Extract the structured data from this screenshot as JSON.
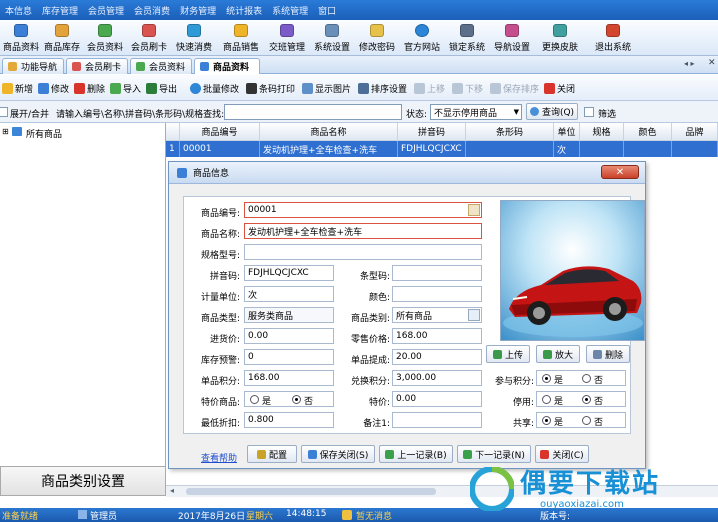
{
  "menubar": {
    "items": [
      "本信息",
      "库存管理",
      "会员管理",
      "会员消费",
      "财务管理",
      "统计报表",
      "系统管理",
      "窗口"
    ]
  },
  "toolbar": {
    "items": [
      "商品资料",
      "商品库存",
      "会员资料",
      "会员刷卡",
      "快速消费",
      "商品销售",
      "交班管理",
      "系统设置",
      "修改密码",
      "官方网站",
      "锁定系统",
      "导航设置",
      "更换皮肤",
      "退出系统"
    ]
  },
  "tabs": [
    "功能导航",
    "会员刷卡",
    "会员资料",
    "商品资料"
  ],
  "actions": {
    "add": "新增",
    "edit": "修改",
    "delete": "删除",
    "import": "导入",
    "export": "导出",
    "batch_edit": "批量修改",
    "barcode_print": "条码打印",
    "show_image": "显示图片",
    "sort_settings": "排序设置",
    "move_up": "上移",
    "move_down": "下移",
    "save_sort": "保存排序",
    "close": "关闭"
  },
  "search": {
    "expand_label": "展开/合并",
    "prompt": "请输入编号\\名称\\拼音码\\条形码\\规格查找:",
    "query": "",
    "status_label": "状态:",
    "status_value": "不显示停用商品",
    "query_button": "查询(Q)",
    "filter_label": "筛选"
  },
  "tree": {
    "root": "所有商品"
  },
  "category_button": "商品类别设置",
  "grid": {
    "headers": [
      "商品编号",
      "商品名称",
      "拼音码",
      "条形码",
      "单位",
      "规格",
      "颜色",
      "品牌"
    ],
    "rows": [
      {
        "index": "1",
        "code": "00001",
        "name": "发动机护理+全车检查+洗车",
        "pinyin": "FDJHLQCJCXC",
        "barcode": "",
        "unit": "次",
        "spec": "",
        "color": "",
        "brand": ""
      }
    ]
  },
  "dialog": {
    "title": "商品信息",
    "labels": {
      "code": "商品编号:",
      "name": "商品名称:",
      "spec": "规格型号:",
      "pinyin": "拼音码:",
      "barcode": "条型码:",
      "unit": "计量单位:",
      "color": "颜色:",
      "type": "商品类型:",
      "category": "商品类别:",
      "purchase_price": "进货价:",
      "retail_price": "零售价格:",
      "stock_alert": "库存预警:",
      "commission": "单品提成:",
      "points": "单品积分:",
      "exchange_points": "兑换积分:",
      "join_points": "参与积分:",
      "special": "特价商品:",
      "special_price": "特价:",
      "disabled": "停用:",
      "min_discount": "最低折扣:",
      "note": "备注1:",
      "shared": "共享:"
    },
    "values": {
      "code": "00001",
      "name": "发动机护理+全车检查+洗车",
      "spec": "",
      "pinyin": "FDJHLQCJCXC",
      "barcode": "",
      "unit": "次",
      "color": "",
      "type": "服务类商品",
      "category": "所有商品",
      "purchase_price": "0.00",
      "retail_price": "168.00",
      "stock_alert": "0",
      "commission": "20.00",
      "points": "168.00",
      "exchange_points": "3,000.00",
      "special_price": "0.00",
      "min_discount": "0.800",
      "note": ""
    },
    "radio": {
      "yes": "是",
      "no": "否"
    },
    "image_buttons": {
      "upload": "上传",
      "zoom": "放大",
      "delete": "删除"
    },
    "footer": {
      "help": "查看帮助",
      "config": "配置",
      "save_close": "保存关闭(S)",
      "prev": "上一记录(B)",
      "next": "下一记录(N)",
      "close": "关闭(C)"
    }
  },
  "status": {
    "ready": "准备就绪",
    "user": "管理员",
    "date": "2017年8月26日",
    "weekday": "星期六",
    "time": "14:48:15",
    "message": "暂无消息",
    "version": "版本号:"
  },
  "watermark": {
    "text": "偶要下载站",
    "url": "ouyaoxiazai.com"
  }
}
